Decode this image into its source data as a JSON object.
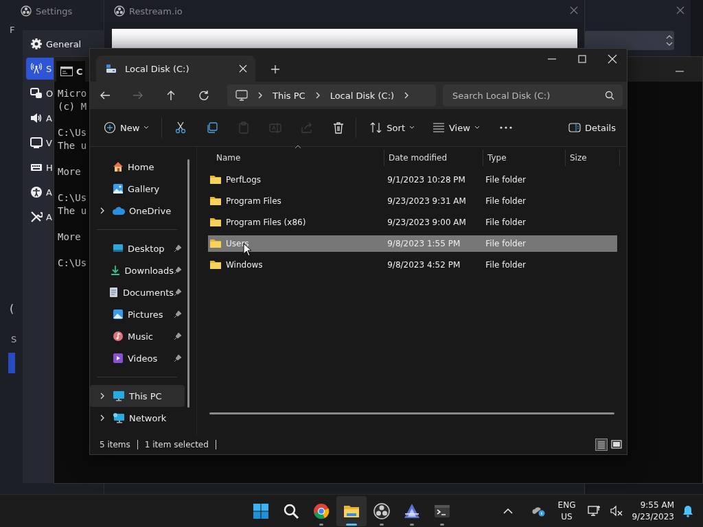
{
  "settings_window": {
    "title": "Settings",
    "menu_letter": "F",
    "fragments": [
      "(",
      "S"
    ],
    "items": [
      {
        "label": "General",
        "selected": false
      },
      {
        "label": "S",
        "selected": true
      },
      {
        "label": "O",
        "selected": false
      },
      {
        "label": "A",
        "selected": false
      },
      {
        "label": "V",
        "selected": false
      },
      {
        "label": "H",
        "selected": false
      },
      {
        "label": "A",
        "selected": false
      },
      {
        "label": "A",
        "selected": false
      }
    ]
  },
  "restream_window": {
    "title": "Restream.io"
  },
  "terminal_window": {
    "tab_title": "C",
    "blocks": [
      [
        "Micro",
        "(c) M"
      ],
      [
        "C:\\Us",
        "The u"
      ],
      [
        "More"
      ],
      [
        "C:\\Us",
        "The u"
      ],
      [
        "More"
      ],
      [
        "C:\\Us"
      ]
    ]
  },
  "explorer": {
    "tab_title": "Local Disk (C:)",
    "nav_buttons": [
      {
        "disabled": false
      },
      {
        "disabled": true
      },
      {
        "disabled": false
      },
      {
        "disabled": false
      }
    ],
    "breadcrumb": [
      "This PC",
      "Local Disk (C:)"
    ],
    "search": {
      "placeholder": "Search Local Disk (C:)"
    },
    "new_label": "New",
    "actions": [
      {
        "disabled": false
      },
      {
        "disabled": false
      },
      {
        "disabled": true
      },
      {
        "disabled": true
      },
      {
        "disabled": true
      },
      {
        "disabled": false
      }
    ],
    "sort_label": "Sort",
    "view_label": "View",
    "details_label": "Details",
    "nav_sections": [
      [
        {
          "label": "Home",
          "expandable": false,
          "pinned": false,
          "selected": false
        },
        {
          "label": "Gallery",
          "expandable": false,
          "pinned": false,
          "selected": false
        },
        {
          "label": "OneDrive",
          "expandable": true,
          "pinned": false,
          "selected": false
        }
      ],
      [
        {
          "label": "Desktop",
          "expandable": false,
          "pinned": true,
          "selected": false
        },
        {
          "label": "Downloads",
          "expandable": false,
          "pinned": true,
          "selected": false
        },
        {
          "label": "Documents",
          "expandable": false,
          "pinned": true,
          "selected": false
        },
        {
          "label": "Pictures",
          "expandable": false,
          "pinned": true,
          "selected": false
        },
        {
          "label": "Music",
          "expandable": false,
          "pinned": true,
          "selected": false
        },
        {
          "label": "Videos",
          "expandable": false,
          "pinned": true,
          "selected": false
        }
      ],
      [
        {
          "label": "This PC",
          "expandable": true,
          "pinned": false,
          "selected": true
        },
        {
          "label": "Network",
          "expandable": true,
          "pinned": false,
          "selected": false
        }
      ]
    ],
    "columns": [
      "Name",
      "Date modified",
      "Type",
      "Size"
    ],
    "rows": [
      {
        "name": "PerfLogs",
        "date": "9/1/2023 10:28 PM",
        "type": "File folder",
        "selected": false
      },
      {
        "name": "Program Files",
        "date": "9/23/2023 9:31 AM",
        "type": "File folder",
        "selected": false
      },
      {
        "name": "Program Files (x86)",
        "date": "9/23/2023 9:00 AM",
        "type": "File folder",
        "selected": false
      },
      {
        "name": "Users",
        "date": "9/8/2023 1:55 PM",
        "type": "File folder",
        "selected": true
      },
      {
        "name": "Windows",
        "date": "9/8/2023 4:52 PM",
        "type": "File folder",
        "selected": false
      }
    ],
    "status": {
      "count": "5 items",
      "selection": "1 item selected"
    }
  },
  "taskbar": {
    "apps": [
      {
        "running": false,
        "active": false
      },
      {
        "running": false,
        "active": false
      },
      {
        "running": true,
        "active": false
      },
      {
        "running": true,
        "active": true
      },
      {
        "running": true,
        "active": false
      },
      {
        "running": true,
        "active": false
      },
      {
        "running": true,
        "active": false
      }
    ],
    "language": "ENG",
    "region": "US",
    "time": "9:55 AM",
    "date": "9/23/2023"
  }
}
